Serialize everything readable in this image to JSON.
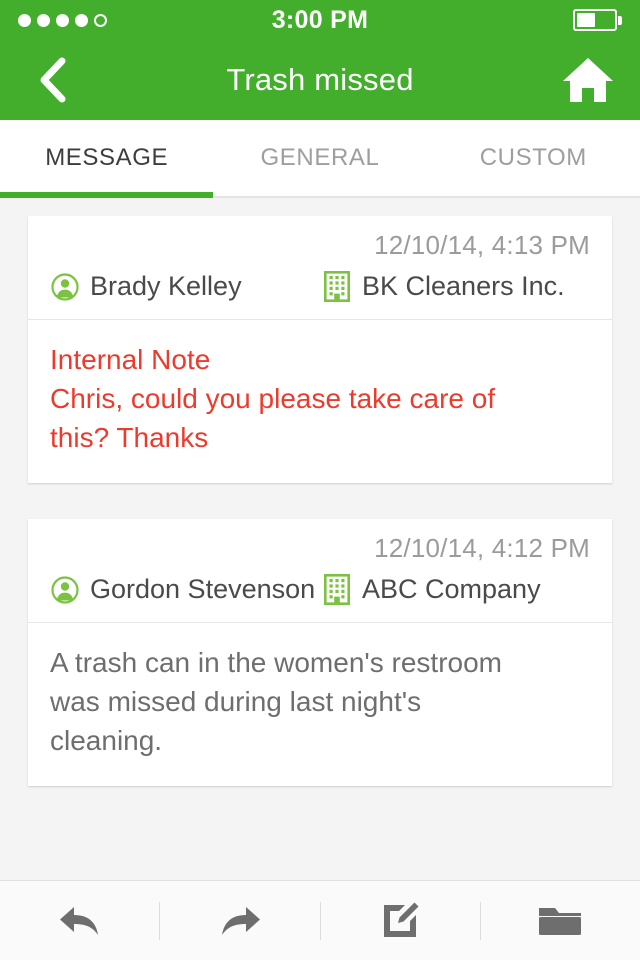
{
  "status_bar": {
    "time": "3:00 PM",
    "signal_dots_total": 5,
    "signal_dots_filled": 4,
    "battery_percent": 50,
    "battery_icon": "battery-half-icon"
  },
  "nav_bar": {
    "title": "Trash missed",
    "back_icon": "chevron-left-icon",
    "home_icon": "home-icon"
  },
  "tabs": {
    "items": [
      {
        "label": "MESSAGE",
        "active": true
      },
      {
        "label": "GENERAL",
        "active": false
      },
      {
        "label": "CUSTOM",
        "active": false
      }
    ],
    "active_indicator_color": "#42ae2c"
  },
  "messages": [
    {
      "timestamp": "12/10/14, 4:13 PM",
      "person": "Brady Kelley",
      "person_icon": "person-circle-icon",
      "company": "BK Cleaners Inc.",
      "company_icon": "building-icon",
      "body": "Internal Note\nChris, could you please take care of\nthis? Thanks",
      "is_internal_note": true
    },
    {
      "timestamp": "12/10/14, 4:12 PM",
      "person": "Gordon Stevenson",
      "person_icon": "person-circle-icon",
      "company": "ABC Company",
      "company_icon": "building-icon",
      "body": "A trash can in the women's restroom\nwas missed during last night's\ncleaning.",
      "is_internal_note": false
    }
  ],
  "toolbar": {
    "buttons": [
      {
        "name": "reply-button",
        "icon": "reply-arrow-icon"
      },
      {
        "name": "forward-button",
        "icon": "forward-arrow-icon"
      },
      {
        "name": "compose-button",
        "icon": "compose-pencil-icon"
      },
      {
        "name": "folder-button",
        "icon": "folder-icon"
      }
    ]
  },
  "colors": {
    "brand_green": "#42ae2c",
    "internal_note_red": "#ec3b2c",
    "page_background": "#f4f4f4",
    "card_background": "#ffffff",
    "muted_text": "#9b9b9b"
  }
}
